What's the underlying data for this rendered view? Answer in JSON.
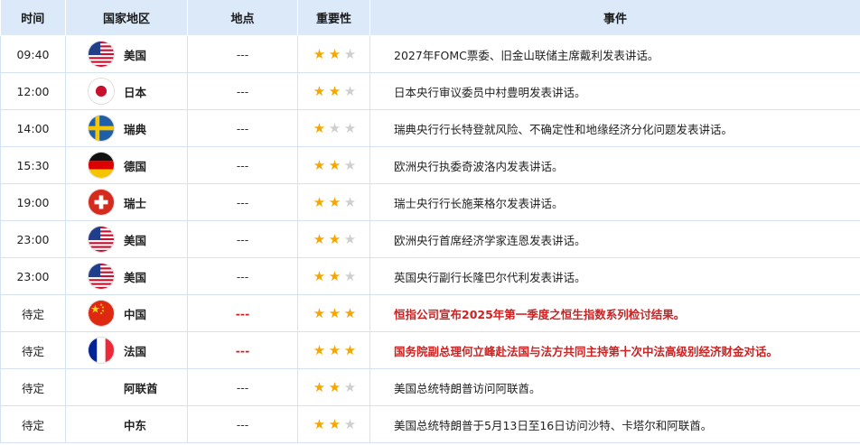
{
  "headers": {
    "time": "时间",
    "country": "国家地区",
    "location": "地点",
    "importance": "重要性",
    "event": "事件"
  },
  "rows": [
    {
      "time": "09:40",
      "country": "美国",
      "flag": "us-flag-icon",
      "location": "---",
      "stars": 2,
      "event": "2027年FOMC票委、旧金山联储主席戴利发表讲话。",
      "highlight": false
    },
    {
      "time": "12:00",
      "country": "日本",
      "flag": "japan-flag-icon",
      "location": "---",
      "stars": 2,
      "event": "日本央行审议委员中村豊明发表讲话。",
      "highlight": false
    },
    {
      "time": "14:00",
      "country": "瑞典",
      "flag": "sweden-flag-icon",
      "location": "---",
      "stars": 1,
      "event": "瑞典央行行长特登就风险、不确定性和地缘经济分化问题发表讲话。",
      "highlight": false
    },
    {
      "time": "15:30",
      "country": "德国",
      "flag": "germany-flag-icon",
      "location": "---",
      "stars": 2,
      "event": "欧洲央行执委奇波洛内发表讲话。",
      "highlight": false
    },
    {
      "time": "19:00",
      "country": "瑞士",
      "flag": "switzerland-flag-icon",
      "location": "---",
      "stars": 2,
      "event": "瑞士央行行长施莱格尔发表讲话。",
      "highlight": false
    },
    {
      "time": "23:00",
      "country": "美国",
      "flag": "us-flag-icon",
      "location": "---",
      "stars": 2,
      "event": "欧洲央行首席经济学家连恩发表讲话。",
      "highlight": false
    },
    {
      "time": "23:00",
      "country": "美国",
      "flag": "us-flag-icon",
      "location": "---",
      "stars": 2,
      "event": "英国央行副行长隆巴尔代利发表讲话。",
      "highlight": false
    },
    {
      "time": "待定",
      "country": "中国",
      "flag": "china-flag-icon",
      "location": "---",
      "stars": 3,
      "event": "恒指公司宣布2025年第一季度之恒生指数系列检讨结果。",
      "highlight": true
    },
    {
      "time": "待定",
      "country": "法国",
      "flag": "france-flag-icon",
      "location": "---",
      "stars": 3,
      "event": "国务院副总理何立峰赴法国与法方共同主持第十次中法高级别经济财金对话。",
      "highlight": true
    },
    {
      "time": "待定",
      "country": "阿联酋",
      "flag": "",
      "location": "---",
      "stars": 2,
      "event": "美国总统特朗普访问阿联酋。",
      "highlight": false
    },
    {
      "time": "待定",
      "country": "中东",
      "flag": "",
      "location": "---",
      "stars": 2,
      "event": "美国总统特朗普于5月13日至16日访问沙特、卡塔尔和阿联酋。",
      "highlight": false
    }
  ],
  "colors": {
    "header_bg": "#dce9f8",
    "star_on": "#f5a700",
    "star_off": "#cfcfcf",
    "highlight_text": "#cc2222"
  }
}
